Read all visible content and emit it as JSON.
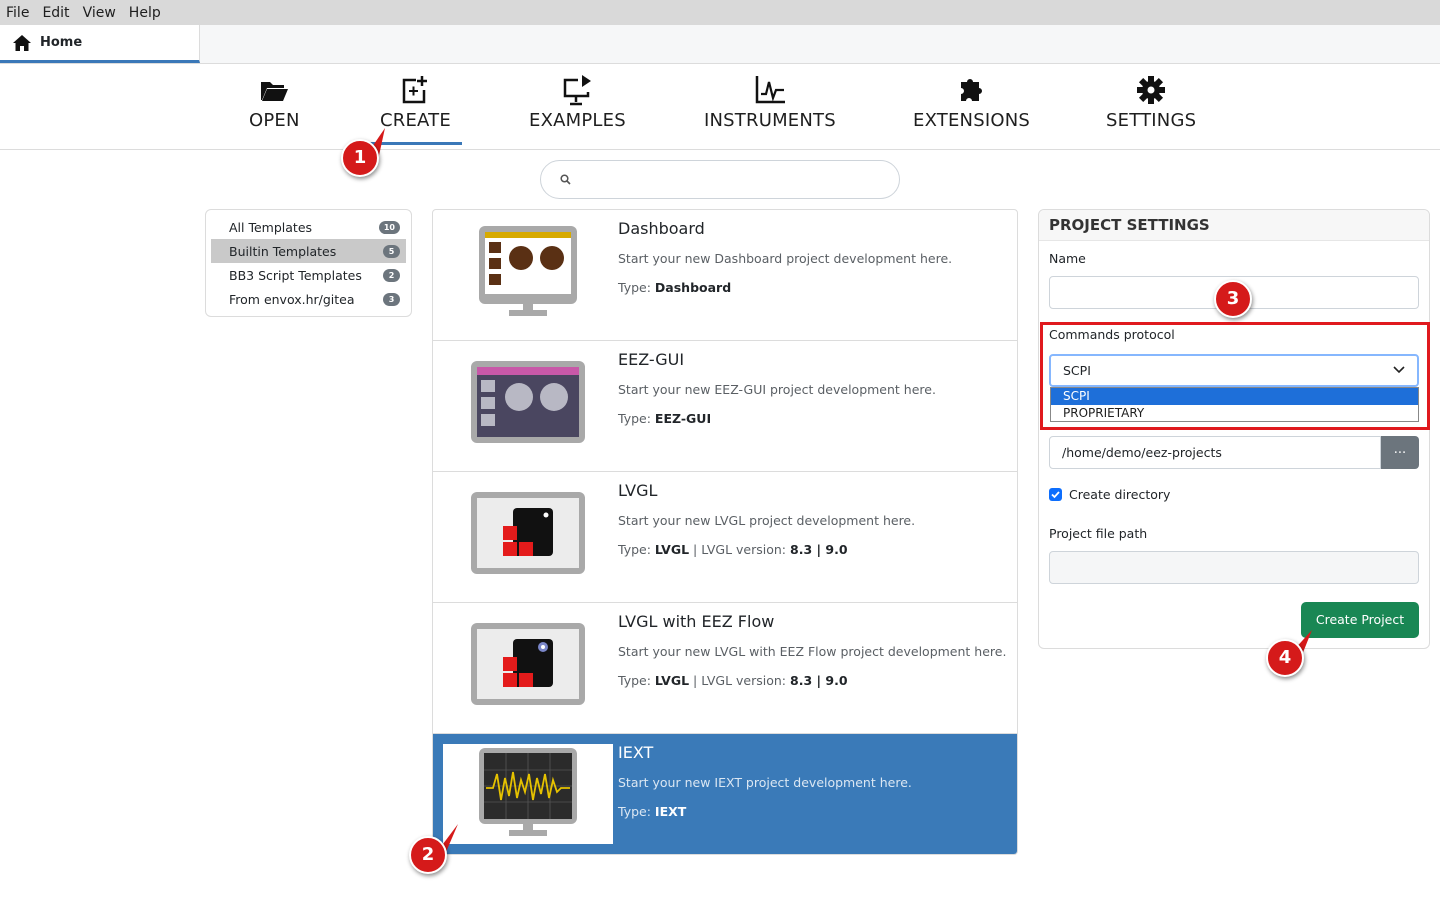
{
  "menu": [
    "File",
    "Edit",
    "View",
    "Help"
  ],
  "tab": {
    "label": "Home"
  },
  "nav": {
    "open": "OPEN",
    "create": "CREATE",
    "examples": "EXAMPLES",
    "instruments": "INSTRUMENTS",
    "extensions": "EXTENSIONS",
    "settings": "SETTINGS"
  },
  "search": {
    "placeholder": ""
  },
  "folders": [
    {
      "label": "All Templates",
      "count": "10"
    },
    {
      "label": "Builtin Templates",
      "count": "5"
    },
    {
      "label": "BB3 Script Templates",
      "count": "2"
    },
    {
      "label": "From envox.hr/gitea",
      "count": "3"
    }
  ],
  "templates": [
    {
      "title": "Dashboard",
      "desc": "Start your new Dashboard project development here.",
      "type_label": "Type:",
      "type": "Dashboard"
    },
    {
      "title": "EEZ-GUI",
      "desc": "Start your new EEZ-GUI project development here.",
      "type_label": "Type:",
      "type": "EEZ-GUI"
    },
    {
      "title": "LVGL",
      "desc": "Start your new LVGL project development here.",
      "type_label": "Type:",
      "type": "LVGL",
      "version_label": "LVGL version:",
      "version": "8.3 | 9.0"
    },
    {
      "title": "LVGL with EEZ Flow",
      "desc": "Start your new LVGL with EEZ Flow project development here.",
      "type_label": "Type:",
      "type": "LVGL",
      "version_label": "LVGL version:",
      "version": "8.3 | 9.0"
    },
    {
      "title": "IEXT",
      "desc": "Start your new IEXT project development here.",
      "type_label": "Type:",
      "type": "IEXT"
    }
  ],
  "settings": {
    "heading": "PROJECT SETTINGS",
    "name_label": "Name",
    "name_value": "",
    "protocol_label": "Commands protocol",
    "protocol_value": "SCPI",
    "protocol_options": [
      "SCPI",
      "PROPRIETARY"
    ],
    "location_value": "/home/demo/eez-projects",
    "browse_label": "...",
    "create_dir_label": "Create directory",
    "path_label": "Project file path",
    "path_value": "",
    "create_button": "Create Project"
  },
  "markers": [
    "1",
    "2",
    "3",
    "4"
  ],
  "colors": {
    "accent": "#3a78b8",
    "selected_row": "#3a7ab8",
    "create_button": "#198754",
    "marker": "#d51a1a"
  }
}
